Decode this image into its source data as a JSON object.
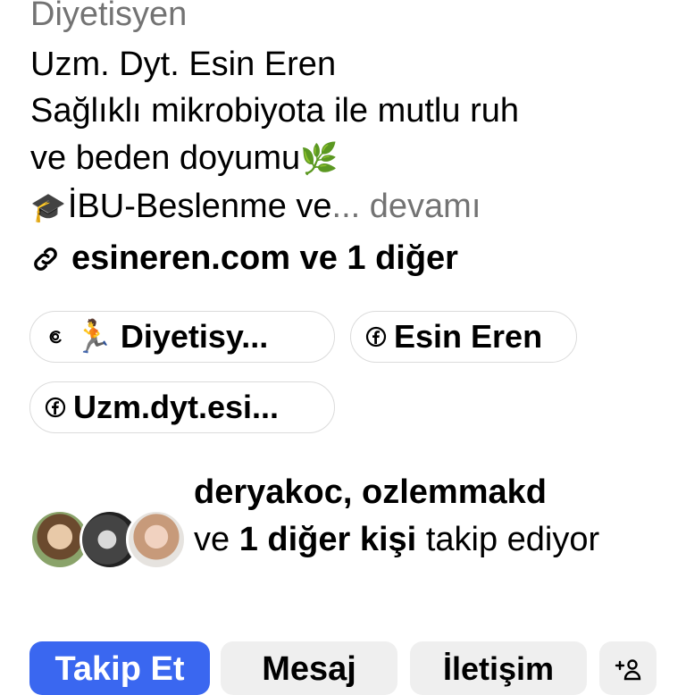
{
  "profile": {
    "category": "Diyetisyen",
    "name": "Uzm. Dyt. Esin Eren",
    "bio_line1": "Sağlıklı mikrobiyota ile mutlu ruh",
    "bio_line2": "ve beden doyumu",
    "bio_line3": "İBU-Beslenme ve",
    "bio_ellipsis": "...",
    "bio_more": "devamı",
    "emoji_leaf": "🌿",
    "emoji_cap": "🎓",
    "link_text": "esineren.com ve 1 diğer"
  },
  "chips": [
    {
      "label": "Diyetisy...",
      "icon": "threads-icon",
      "emoji": "🏃"
    },
    {
      "label": "Esin Eren",
      "icon": "facebook-icon"
    },
    {
      "label": "Uzm.dyt.esi...",
      "icon": "facebook-icon"
    }
  ],
  "followers": {
    "names": "deryakoc, ozlemmakd",
    "prefix": "ve",
    "count_text": "1 diğer kişi",
    "suffix": "takip ediyor"
  },
  "actions": {
    "follow": "Takip Et",
    "message": "Mesaj",
    "contact": "İletişim",
    "add_icon": "+8"
  },
  "colors": {
    "primary_button": "#3a67f0",
    "secondary_text": "#737373"
  }
}
